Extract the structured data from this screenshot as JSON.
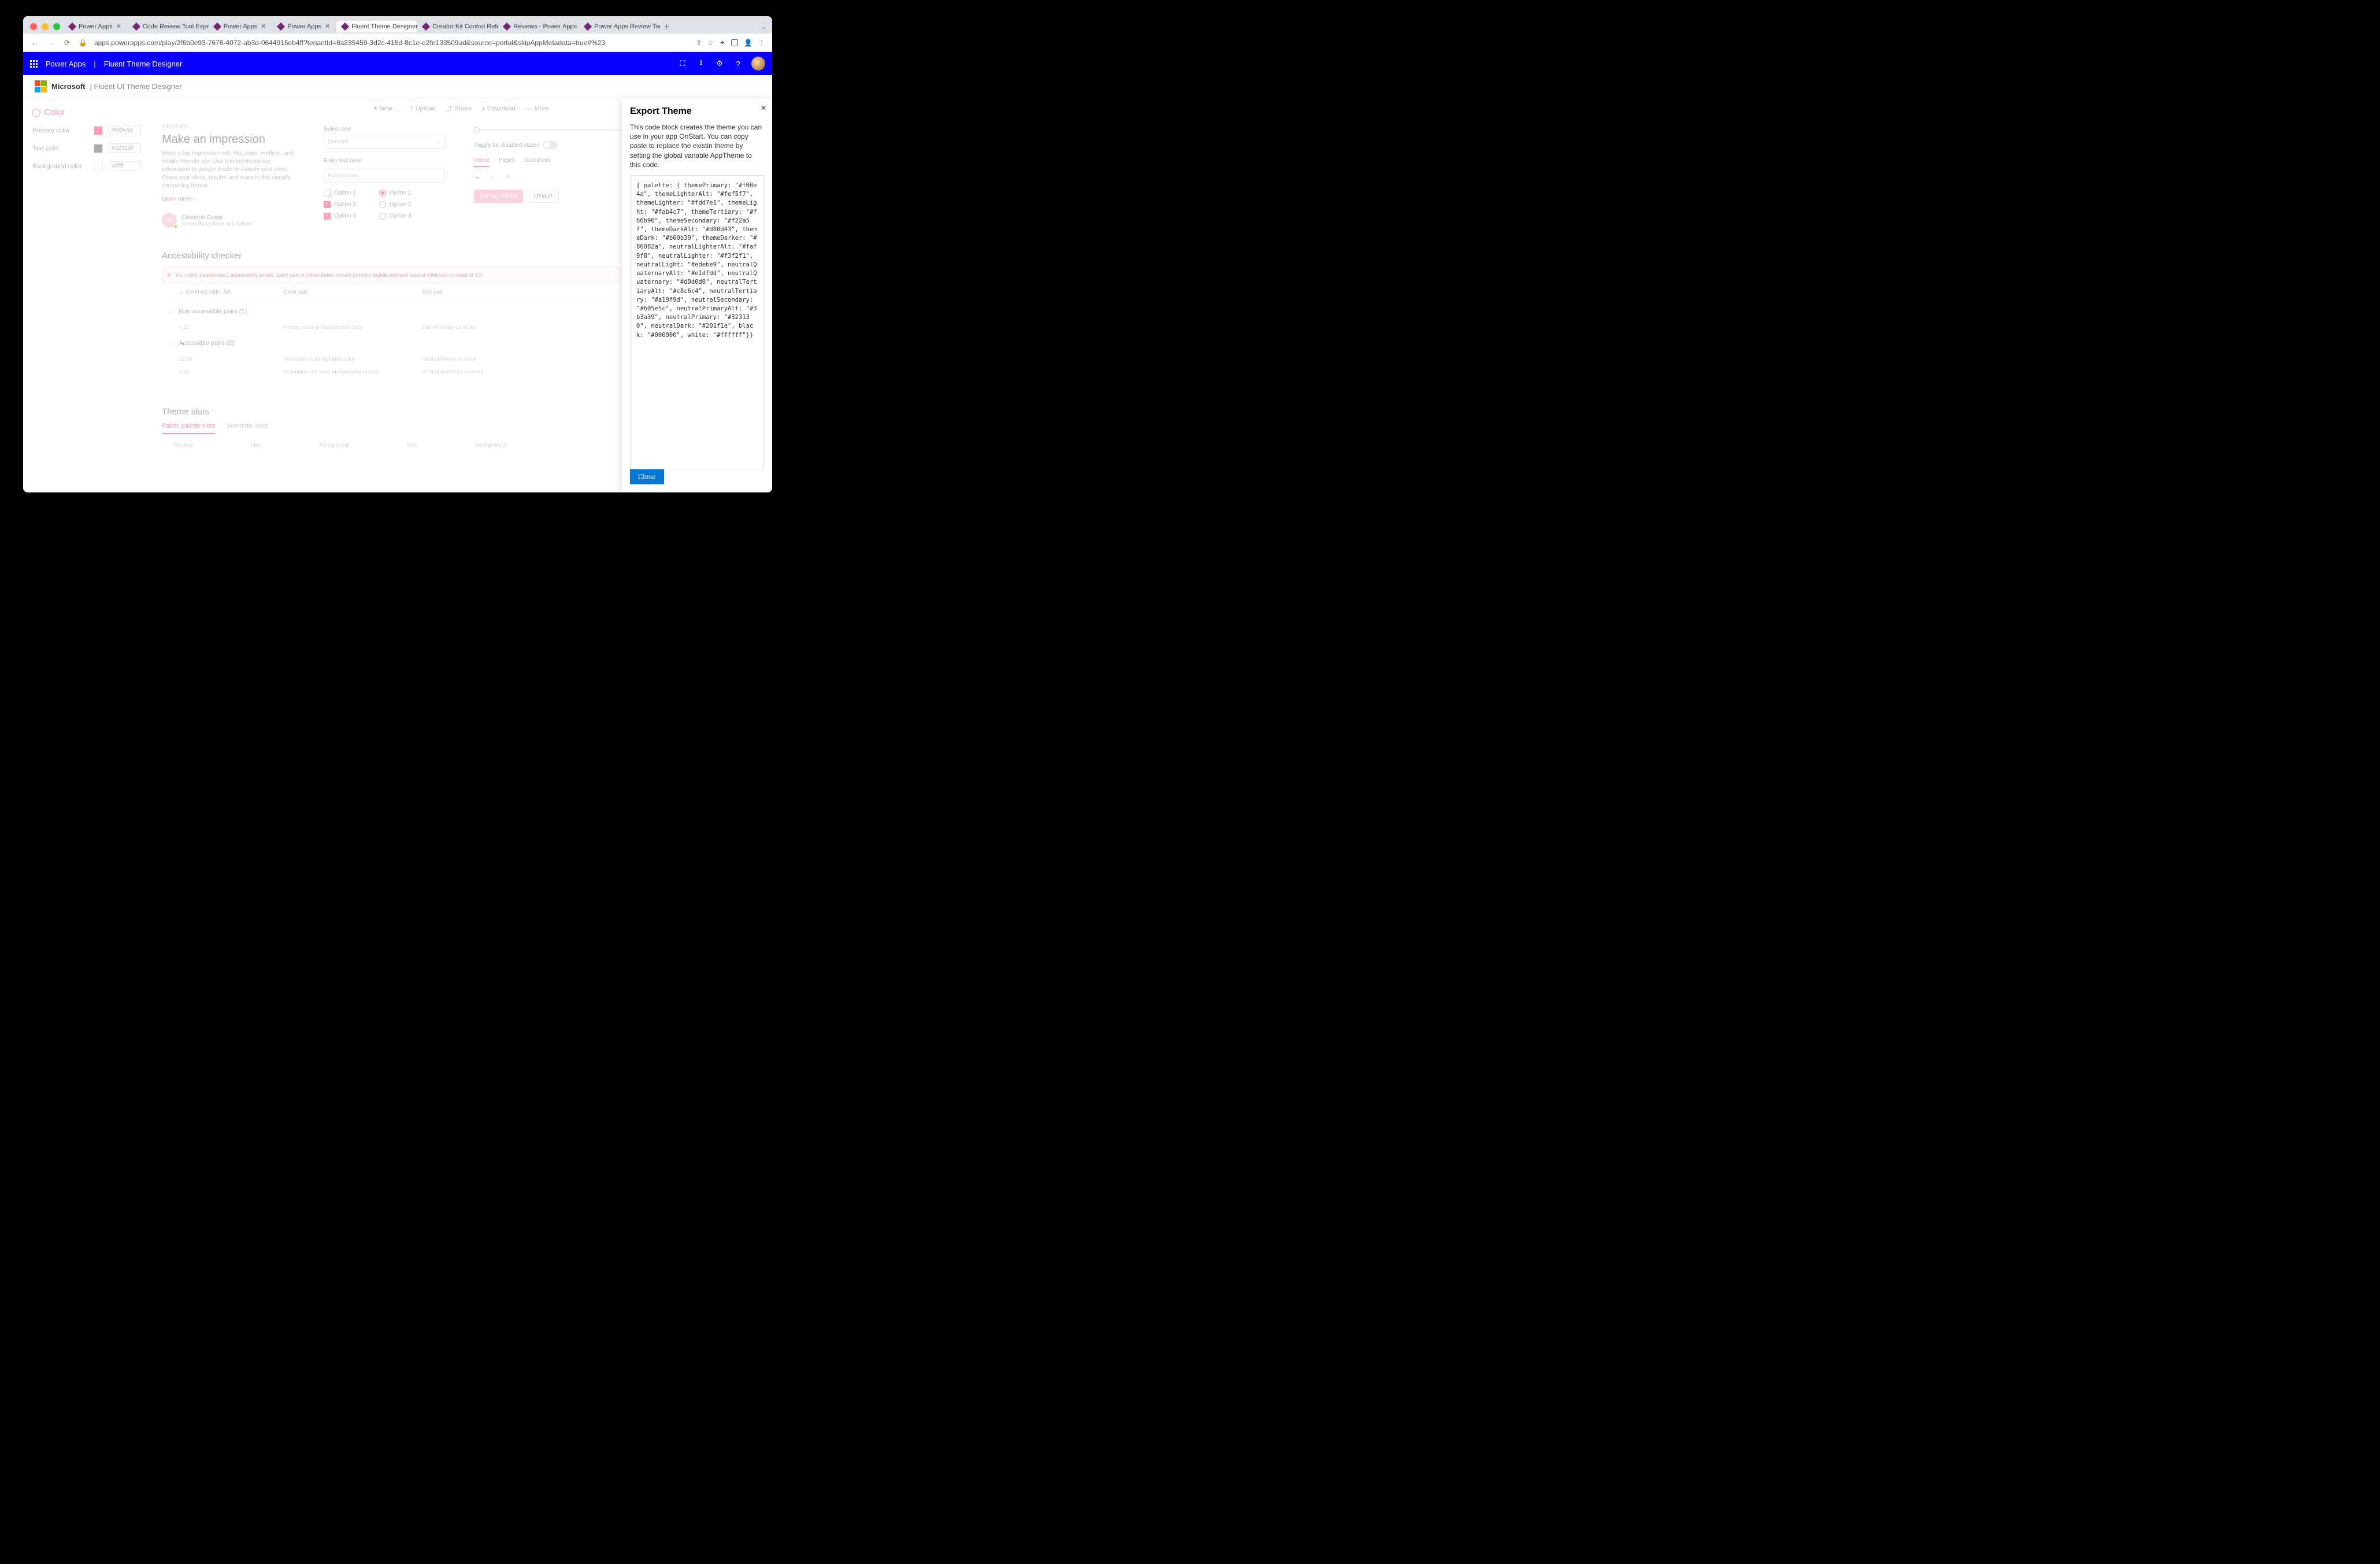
{
  "browser": {
    "tabs": [
      {
        "title": "Power Apps"
      },
      {
        "title": "Code Review Tool Experim"
      },
      {
        "title": "Power Apps"
      },
      {
        "title": "Power Apps"
      },
      {
        "title": "Fluent Theme Designer - P",
        "active": true
      },
      {
        "title": "Creator Kit Control Referen"
      },
      {
        "title": "Reviews - Power Apps"
      },
      {
        "title": "Power Apps Review Tool -"
      }
    ],
    "url": "apps.powerapps.com/play/2f6b0e93-7676-4072-ab3d-0644915eb4ff?tenantId=8a235459-3d2c-415d-8c1e-e2fe133509ad&source=portal&skipAppMetadata=true#%23"
  },
  "header": {
    "app_name": "Power Apps",
    "page_name": "Fluent Theme Designer"
  },
  "sub_header": {
    "brand": "Microsoft",
    "title": "| Fluent UI Theme Designer"
  },
  "left": {
    "heading": "Color",
    "rows": [
      {
        "label": "Primary color",
        "swatch": "#f00e4a",
        "value": "#f00e4a"
      },
      {
        "label": "Text color",
        "swatch": "#323130",
        "value": "#323130"
      },
      {
        "label": "Background color",
        "swatch": "#ffffff",
        "value": "#ffffff"
      }
    ]
  },
  "toolbar": [
    {
      "icon": "plus",
      "label": "New"
    },
    {
      "icon": "upload",
      "label": "Upload"
    },
    {
      "icon": "share",
      "label": "Share"
    },
    {
      "icon": "download",
      "label": "Download"
    },
    {
      "icon": "more",
      "label": "More"
    }
  ],
  "hero": {
    "eyebrow": "STORIES",
    "title": "Make an impression",
    "body": "Make a big impression with this clean, modern, and mobile-friendly site. Use it to communicate information to people inside or outisde your team. Share your ideas, results, and more in this visually compelling format.",
    "learn_more": "Learn more",
    "persona": {
      "initials": "CE",
      "name": "Cameron Evans",
      "role": "Senior Researcher at Contoso"
    }
  },
  "form": {
    "select_label": "Select one",
    "select_value": "Content",
    "enter_label": "Enter text here",
    "placeholder": "Placeholder",
    "checkboxes": [
      {
        "label": "Option 1",
        "checked": false
      },
      {
        "label": "Option 2",
        "checked": true
      },
      {
        "label": "Option 3",
        "checked": true
      }
    ],
    "radios": [
      {
        "label": "Option 1",
        "checked": true
      },
      {
        "label": "Option 2",
        "checked": false
      },
      {
        "label": "Option 3",
        "checked": false
      }
    ]
  },
  "right": {
    "toggle_label": "Toggle for disabled states",
    "tabs": [
      "Home",
      "Pages",
      "Document"
    ],
    "primary_button": "Primary button",
    "default_button": "Default"
  },
  "accessibility": {
    "heading": "Accessibility checker",
    "error": "Your color palette has 1 accessibility errors. Each pair of colors below should produce legible text and have a minimum contrast of 4.5",
    "columns": [
      "Contrast ratio: AA",
      "Color pair",
      "Slot pair"
    ],
    "groups": [
      {
        "title": "Non accessible pairs (1)",
        "rows": [
          {
            "ratio": "4.31",
            "pair": "Primary color on Background color",
            "slot": "themePrimary on white"
          }
        ]
      },
      {
        "title": "Accessible pairs (2)",
        "rows": [
          {
            "ratio": "12.98",
            "pair": "Text color on Background color",
            "slot": "neutralPrimary on white"
          },
          {
            "ratio": "6.46",
            "pair": "Secondary text color on Background color",
            "slot": "neutralSecondary on white"
          }
        ]
      }
    ]
  },
  "slots": {
    "heading": "Theme slots",
    "tabs": [
      "Fabric palette slots",
      "Semantic slots"
    ],
    "columns": [
      "Primary",
      "Hex",
      "Foreground",
      "Hex",
      "Background"
    ]
  },
  "panel": {
    "title": "Export Theme",
    "description": "This code block creates the theme you can use in your app OnStart. You can copy paste to replace the existin theme by setting the global variable AppTheme to this code.",
    "code": "{ palette: { themePrimary: \"#f00e4a\", themeLighterAlt: \"#fef5f7\", themeLighter: \"#fdd7e1\", themeLight: \"#fab4c7\", themeTertiary: \"#f66b90\", themeSecondary: \"#f22a5f\", themeDarkAlt: \"#d80d43\", themeDark: \"#b60b39\", themeDarker: \"#86082a\", neutralLighterAlt: \"#faf9f8\", neutralLighter: \"#f3f2f1\", neutralLight: \"#edebe9\", neutralQuaternaryAlt: \"#e1dfdd\", neutralQuaternary: \"#d0d0d0\", neutralTertiaryAlt: \"#c8c6c4\", neutralTertiary: \"#a19f9d\", neutralSecondary: \"#605e5c\", neutralPrimaryAlt: \"#3b3a39\", neutralPrimary: \"#323130\", neutralDark: \"#201f1e\", black: \"#000000\", white: \"#ffffff\"}}",
    "close": "Close"
  }
}
